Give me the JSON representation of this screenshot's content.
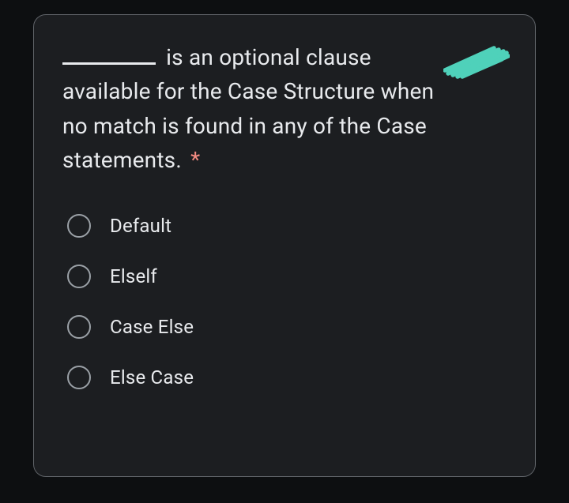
{
  "question": {
    "pre_blank": "",
    "post_blank": "is an optional clause available for the Case Structure when no match is found in any of the Case statements.",
    "required_marker": "*"
  },
  "options": [
    {
      "label": "Default"
    },
    {
      "label": "Elself"
    },
    {
      "label": "Case Else"
    },
    {
      "label": "Else Case"
    }
  ],
  "accent_color": "#4fd1ba"
}
